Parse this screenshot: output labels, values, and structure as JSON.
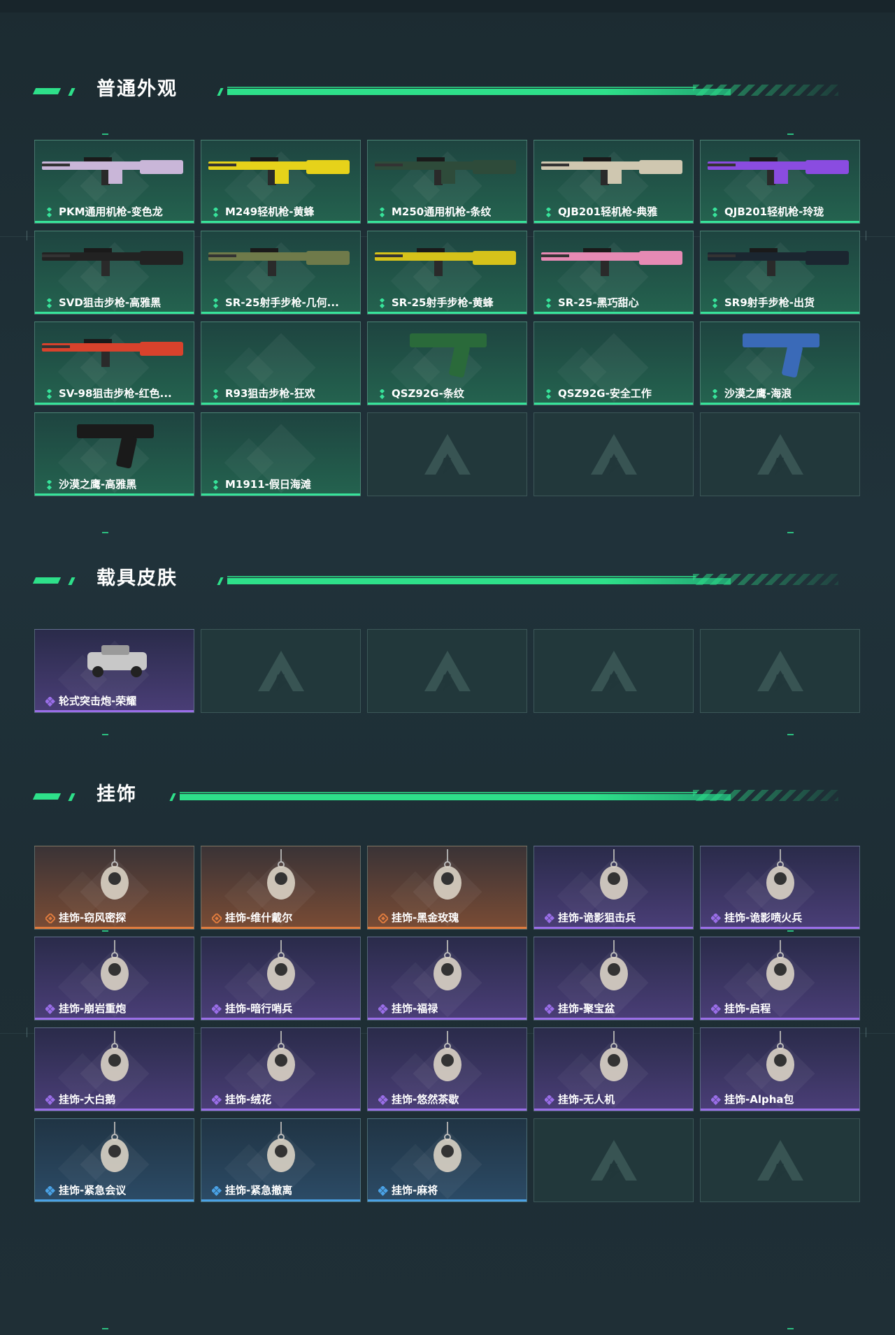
{
  "sections": [
    {
      "title": "普通外观",
      "items": [
        {
          "label": "PKM通用机枪-变色龙",
          "rarity": "green",
          "icon": "machine-gun-icon"
        },
        {
          "label": "M249轻机枪-黄蜂",
          "rarity": "green",
          "icon": "machine-gun-icon"
        },
        {
          "label": "M250通用机枪-条纹",
          "rarity": "green",
          "icon": "machine-gun-icon"
        },
        {
          "label": "QJB201轻机枪-典雅",
          "rarity": "green",
          "icon": "machine-gun-icon"
        },
        {
          "label": "QJB201轻机枪-玲珑",
          "rarity": "green",
          "icon": "machine-gun-icon"
        },
        {
          "label": "SVD狙击步枪-高雅黑",
          "rarity": "green",
          "icon": "sniper-rifle-icon"
        },
        {
          "label": "SR-25射手步枪-几何...",
          "rarity": "green",
          "icon": "rifle-icon"
        },
        {
          "label": "SR-25射手步枪-黄蜂",
          "rarity": "green",
          "icon": "rifle-icon"
        },
        {
          "label": "SR-25-黑巧甜心",
          "rarity": "green",
          "icon": "rifle-icon"
        },
        {
          "label": "SR9射手步枪-出货",
          "rarity": "green",
          "icon": "rifle-icon"
        },
        {
          "label": "SV-98狙击步枪-红色...",
          "rarity": "green",
          "icon": "sniper-rifle-icon"
        },
        {
          "label": "R93狙击步枪-狂欢",
          "rarity": "green",
          "icon": ""
        },
        {
          "label": "QSZ92G-条纹",
          "rarity": "green",
          "icon": "pistol-icon"
        },
        {
          "label": "QSZ92G-安全工作",
          "rarity": "green",
          "icon": ""
        },
        {
          "label": "沙漠之鹰-海浪",
          "rarity": "green",
          "icon": "pistol-icon"
        },
        {
          "label": "沙漠之鹰-高雅黑",
          "rarity": "green",
          "icon": "pistol-icon"
        },
        {
          "label": "M1911-假日海滩",
          "rarity": "green",
          "icon": ""
        }
      ],
      "empty_slots": 3
    },
    {
      "title": "载具皮肤",
      "items": [
        {
          "label": "轮式突击炮-荣耀",
          "rarity": "purple",
          "icon": "armored-vehicle-icon"
        }
      ],
      "empty_slots": 4
    },
    {
      "title": "挂饰",
      "items": [
        {
          "label": "挂饰-窃风密探",
          "rarity": "orange",
          "icon": "charm-icon"
        },
        {
          "label": "挂饰-维什戴尔",
          "rarity": "orange",
          "icon": "charm-icon"
        },
        {
          "label": "挂饰-黑金玫瑰",
          "rarity": "orange",
          "icon": "charm-icon"
        },
        {
          "label": "挂饰-诡影狙击兵",
          "rarity": "purple",
          "icon": "charm-icon"
        },
        {
          "label": "挂饰-诡影喷火兵",
          "rarity": "purple",
          "icon": "charm-icon"
        },
        {
          "label": "挂饰-崩岩重炮",
          "rarity": "purple",
          "icon": "charm-icon"
        },
        {
          "label": "挂饰-暗行哨兵",
          "rarity": "purple",
          "icon": "charm-icon"
        },
        {
          "label": "挂饰-福禄",
          "rarity": "purple",
          "icon": "charm-icon"
        },
        {
          "label": "挂饰-聚宝盆",
          "rarity": "purple",
          "icon": "charm-icon"
        },
        {
          "label": "挂饰-启程",
          "rarity": "purple",
          "icon": "charm-icon"
        },
        {
          "label": "挂饰-大白鹅",
          "rarity": "purple",
          "icon": "charm-icon"
        },
        {
          "label": "挂饰-绒花",
          "rarity": "purple",
          "icon": "charm-icon"
        },
        {
          "label": "挂饰-悠然茶歇",
          "rarity": "purple",
          "icon": "charm-icon"
        },
        {
          "label": "挂饰-无人机",
          "rarity": "purple",
          "icon": "charm-icon"
        },
        {
          "label": "挂饰-Alpha包",
          "rarity": "purple",
          "icon": "charm-icon"
        },
        {
          "label": "挂饰-紧急会议",
          "rarity": "blue",
          "icon": "charm-icon"
        },
        {
          "label": "挂饰-紧急撤离",
          "rarity": "blue",
          "icon": "charm-icon"
        },
        {
          "label": "挂饰-麻将",
          "rarity": "blue",
          "icon": "charm-icon"
        }
      ],
      "empty_slots": 2
    }
  ],
  "colors": {
    "accent": "#2ee08a",
    "green": "#37e39a",
    "purple": "#9a6ee8",
    "orange": "#e07c3e",
    "blue": "#4aa2e6"
  }
}
